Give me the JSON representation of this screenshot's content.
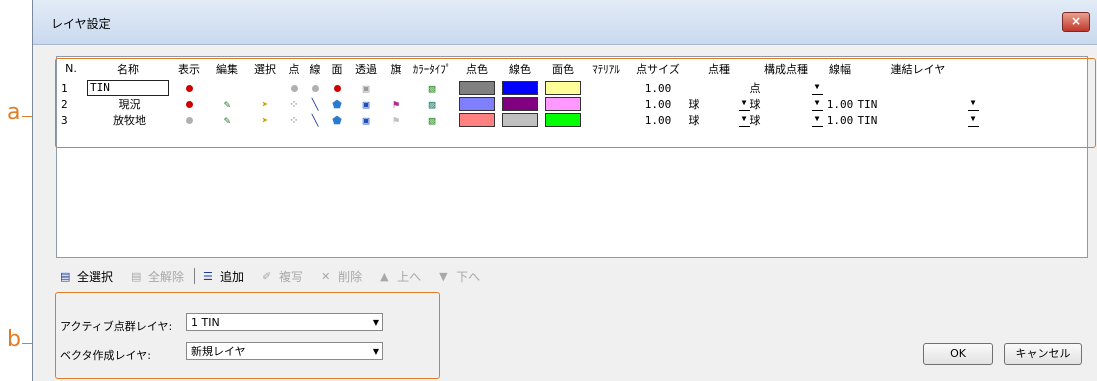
{
  "window": {
    "title": "レイヤ設定",
    "close_label": "×"
  },
  "grid": {
    "headers": [
      "N.",
      "名称",
      "表示",
      "編集",
      "選択",
      "点",
      "線",
      "面",
      "透過",
      "旗",
      "ｶﾗｰﾀｲﾌﾟ",
      "点色",
      "線色",
      "面色",
      "ﾏﾃﾘｱﾙ",
      "点サイズ",
      "点種",
      "構成点種",
      "線幅",
      "連結レイヤ"
    ],
    "rows": [
      {
        "n": "1",
        "name": "TIN",
        "point_size": "1.00",
        "point_type": "",
        "composition": "点",
        "line_width": "",
        "linked": "",
        "point_color": "#808080",
        "line_color": "#0000ff",
        "face_color": "#ffff99"
      },
      {
        "n": "2",
        "name": "現況",
        "point_size": "1.00",
        "point_type": "球",
        "composition": "球",
        "line_width": "1.00",
        "linked": "TIN",
        "point_color": "#8080ff",
        "line_color": "#800080",
        "face_color": "#ff99ff"
      },
      {
        "n": "3",
        "name": "放牧地",
        "point_size": "1.00",
        "point_type": "球",
        "composition": "球",
        "line_width": "1.00",
        "linked": "TIN",
        "point_color": "#ff8080",
        "line_color": "#c0c0c0",
        "face_color": "#00ff00"
      }
    ]
  },
  "toolbar": {
    "select_all": "全選択",
    "deselect_all": "全解除",
    "add": "追加",
    "copy": "複写",
    "delete": "削除",
    "up": "上へ",
    "down": "下へ"
  },
  "form": {
    "active_layer_label": "アクティブ点群レイヤ:",
    "active_layer_value": "1 TIN",
    "vector_layer_label": "ベクタ作成レイヤ:",
    "vector_layer_value": "新規レイヤ"
  },
  "buttons": {
    "ok": "OK",
    "cancel": "キャンセル"
  },
  "annotations": {
    "a": "a",
    "b": "b",
    "color": "#e07b28"
  }
}
